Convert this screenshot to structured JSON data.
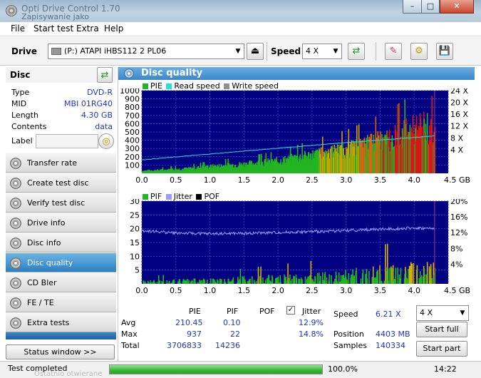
{
  "window": {
    "title": "Opti Drive Control 1.70",
    "ghost_text": "Zapisywanie jako",
    "min": "–",
    "max": "□",
    "close": "✕"
  },
  "menu": [
    "File",
    "Start test",
    "Extra",
    "Help"
  ],
  "toolbar": {
    "drive_label": "Drive",
    "drive_value": "(P:)   ATAPI iHBS112   2 PL06",
    "speed_label": "Speed",
    "speed_value": "4 X"
  },
  "disc": {
    "header": "Disc",
    "rows": [
      {
        "k": "Type",
        "v": "DVD-R"
      },
      {
        "k": "MID",
        "v": "MBI 01RG40"
      },
      {
        "k": "Length",
        "v": "4.30 GB"
      },
      {
        "k": "Contents",
        "v": "data"
      }
    ],
    "label_key": "Label"
  },
  "nav": [
    "Transfer rate",
    "Create test disc",
    "Verify test disc",
    "Drive info",
    "Disc info",
    "Disc quality",
    "CD Bler",
    "FE / TE",
    "Extra tests"
  ],
  "nav_active": 5,
  "status_window_btn": "Status window >>",
  "panel_title": "Disc quality",
  "legend_top": {
    "pie": "PIE",
    "read": "Read speed",
    "write": "Write speed"
  },
  "legend_bottom": {
    "pif": "PIF",
    "jitter": "Jitter",
    "pof": "POF"
  },
  "colors": {
    "pie": "#22b422",
    "read": "#20e0e0",
    "write": "#909090",
    "pif": "#22b422",
    "jitter": "#9a9aff",
    "pof": "#000000",
    "plot_bg": "#000080"
  },
  "chart_data": [
    {
      "type": "bar",
      "series": [
        {
          "name": "PIE"
        },
        {
          "name": "Read speed"
        }
      ],
      "x_ticks": [
        "0.0",
        "0.5",
        "1.0",
        "1.5",
        "2.0",
        "2.5",
        "3.0",
        "3.5",
        "4.0",
        "4.5 GB"
      ],
      "y_ticks": [
        "1000",
        "900",
        "800",
        "700",
        "600",
        "500",
        "400",
        "300",
        "200",
        "100"
      ],
      "y2_ticks": [
        "24 X",
        "20 X",
        "16 X",
        "12 X",
        "8 X",
        "4 X"
      ],
      "xlim": [
        0,
        4.5
      ],
      "ylim": [
        0,
        1000
      ],
      "y2lim": [
        0,
        24
      ],
      "pie_envelope": {
        "x": [
          0,
          0.3,
          0.7,
          1.0,
          1.5,
          2.0,
          2.3,
          2.6,
          3.0,
          3.3,
          3.6,
          3.9,
          4.1,
          4.3
        ],
        "y": [
          40,
          55,
          80,
          110,
          150,
          200,
          260,
          320,
          390,
          470,
          560,
          680,
          760,
          700
        ]
      },
      "read_speed": {
        "x": [
          0,
          1.0,
          2.0,
          3.0,
          4.0,
          4.3
        ],
        "y": [
          3.9,
          5.6,
          7.3,
          8.9,
          10.4,
          10.9
        ]
      }
    },
    {
      "type": "bar",
      "series": [
        {
          "name": "PIF"
        },
        {
          "name": "Jitter"
        },
        {
          "name": "POF"
        }
      ],
      "x_ticks": [
        "0.0",
        "0.5",
        "1.0",
        "1.5",
        "2.0",
        "2.5",
        "3.0",
        "3.5",
        "4.0",
        "4.5 GB"
      ],
      "y_ticks": [
        "30",
        "25",
        "20",
        "15",
        "10",
        "5"
      ],
      "y2_ticks": [
        "20%",
        "16%",
        "12%",
        "8%",
        "4%"
      ],
      "xlim": [
        0,
        4.5
      ],
      "ylim": [
        0,
        30
      ],
      "y2lim": [
        0,
        20
      ],
      "jitter": {
        "x": [
          0,
          0.5,
          1.0,
          1.5,
          2.0,
          2.5,
          3.0,
          3.5,
          4.0,
          4.3
        ],
        "y": [
          12.9,
          12.3,
          12.1,
          12.2,
          12.4,
          12.6,
          12.9,
          13.2,
          13.5,
          13.3
        ]
      },
      "pif_envelope": {
        "x": [
          0,
          1.0,
          2.0,
          2.5,
          3.0,
          3.5,
          4.0,
          4.3
        ],
        "y": [
          2,
          3,
          5,
          6,
          8,
          10,
          12,
          11
        ]
      }
    }
  ],
  "stats": {
    "headers": [
      "PIE",
      "PIF",
      "POF",
      "Jitter"
    ],
    "rows": [
      {
        "k": "Avg",
        "pie": "210.45",
        "pif": "0.10",
        "jit": "12.9%"
      },
      {
        "k": "Max",
        "pie": "937",
        "pif": "22",
        "jit": "14.8%"
      },
      {
        "k": "Total",
        "pie": "3706833",
        "pif": "14236",
        "jit": ""
      }
    ],
    "speed_k": "Speed",
    "speed_v": "6.21 X",
    "position_k": "Position",
    "position_v": "4403 MB",
    "samples_k": "Samples",
    "samples_v": "140334",
    "speed_select": "4 X",
    "start_full": "Start full",
    "start_part": "Start part"
  },
  "status": {
    "text": "Test completed",
    "progress": 1.0,
    "percent": "100.0%",
    "time": "14:22",
    "ghost": "Ostatnio otwierane"
  }
}
